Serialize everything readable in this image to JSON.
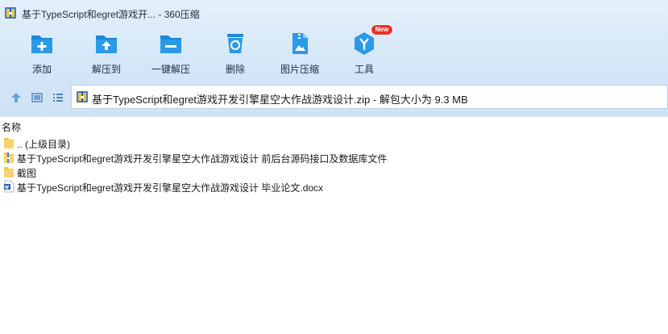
{
  "window": {
    "title": "基于TypeScript和egret游戏开... - 360压缩"
  },
  "toolbar": {
    "items": [
      {
        "label": "添加",
        "icon": "add-icon"
      },
      {
        "label": "解压到",
        "icon": "extract-to-icon"
      },
      {
        "label": "一键解压",
        "icon": "one-click-extract-icon"
      },
      {
        "label": "删除",
        "icon": "delete-icon"
      },
      {
        "label": "图片压缩",
        "icon": "image-compress-icon"
      },
      {
        "label": "工具",
        "icon": "tools-icon",
        "badge": "New"
      }
    ]
  },
  "nav": {
    "path": "基于TypeScript和egret游戏开发引擎星空大作战游戏设计.zip - 解包大小为 9.3 MB"
  },
  "columns": {
    "name": "名称"
  },
  "files": [
    {
      "name": ".. (上级目录)",
      "type": "parent-folder"
    },
    {
      "name": "基于TypeScript和egret游戏开发引擎星空大作战游戏设计 前后台源码接口及数据库文件",
      "type": "folder-zip"
    },
    {
      "name": "截图",
      "type": "folder"
    },
    {
      "name": "基于TypeScript和egret游戏开发引擎星空大作战游戏设计 毕业论文.docx",
      "type": "docx"
    }
  ],
  "colors": {
    "accent": "#1e88d6",
    "toolbar_bg": "#d6e8f9",
    "badge": "#e8322f"
  }
}
